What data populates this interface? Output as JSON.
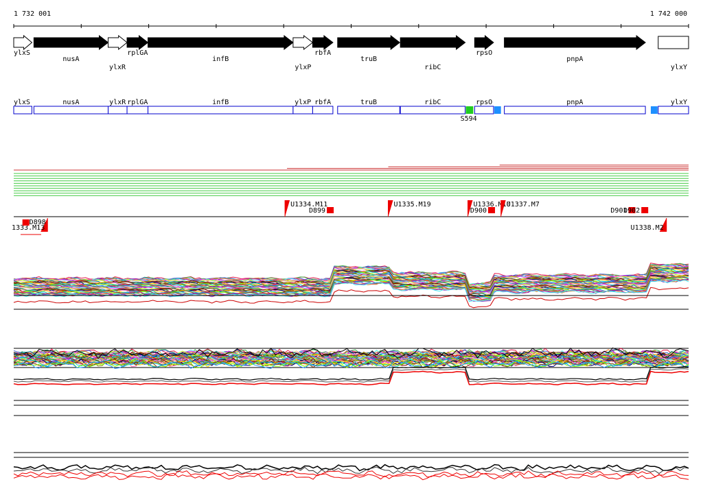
{
  "coords": {
    "start": "1 732 001",
    "end": "1 742 000"
  },
  "genes": [
    {
      "name": "ylxS",
      "start": 1732001,
      "end": 1732270,
      "strand": "+",
      "filled": false,
      "label_row": 1
    },
    {
      "name": "nusA",
      "start": 1732300,
      "end": 1733400,
      "strand": "+",
      "filled": true,
      "label_row": 2
    },
    {
      "name": "ylxR",
      "start": 1733400,
      "end": 1733680,
      "strand": "+",
      "filled": false,
      "label_row": 3
    },
    {
      "name": "rplGA",
      "start": 1733680,
      "end": 1733990,
      "strand": "+",
      "filled": true,
      "label_row": 1
    },
    {
      "name": "infB",
      "start": 1733990,
      "end": 1736140,
      "strand": "+",
      "filled": true,
      "label_row": 2
    },
    {
      "name": "ylxP",
      "start": 1736140,
      "end": 1736430,
      "strand": "+",
      "filled": false,
      "label_row": 3
    },
    {
      "name": "rbfA",
      "start": 1736430,
      "end": 1736730,
      "strand": "+",
      "filled": true,
      "label_row": 1
    },
    {
      "name": "truB",
      "start": 1736800,
      "end": 1737720,
      "strand": "+",
      "filled": true,
      "label_row": 2
    },
    {
      "name": "ribC",
      "start": 1737730,
      "end": 1738690,
      "strand": "+",
      "filled": true,
      "label_row": 3
    },
    {
      "name": "rpsO",
      "start": 1738830,
      "end": 1739110,
      "strand": "+",
      "filled": true,
      "label_row": 1
    },
    {
      "name": "pnpA",
      "start": 1739270,
      "end": 1741360,
      "strand": "+",
      "filled": true,
      "label_row": 2
    },
    {
      "name": "ylxY",
      "start": 1741550,
      "end": 1742000,
      "strand": "+",
      "filled": false,
      "label_row": 3
    }
  ],
  "features": [
    {
      "name": "S594",
      "start": 1738700,
      "end": 1738810,
      "color": "#22cc22"
    },
    {
      "name": "",
      "start": 1739120,
      "end": 1739220,
      "color": "#1e90ff"
    },
    {
      "name": "",
      "start": 1741440,
      "end": 1741540,
      "color": "#1e90ff"
    }
  ],
  "coverage_lines": {
    "green_count": 10,
    "red_lines": [
      {
        "start": 1732001,
        "end": 1742000
      },
      {
        "start": 1736050,
        "end": 1742000
      },
      {
        "start": 1737550,
        "end": 1742000
      },
      {
        "start": 1739200,
        "end": 1742000
      }
    ]
  },
  "segments_upper": [
    {
      "name": "U1334.M11",
      "pos": 1736020
    },
    {
      "name": "U1335.M19",
      "pos": 1737550
    },
    {
      "name": "U1336.M10",
      "pos": 1738730
    },
    {
      "name": "U1337.M7",
      "pos": 1739220
    }
  ],
  "segments_lower": [
    {
      "name": "1333.M13",
      "pos": 1732400
    },
    {
      "name": "U1338.M2",
      "pos": 1741570
    }
  ],
  "boxes": [
    {
      "name": "D898",
      "pos": 1732130,
      "row": "lower"
    },
    {
      "name": "D899",
      "pos": 1736640,
      "row": "upper"
    },
    {
      "name": "D900",
      "pos": 1739030,
      "row": "upper"
    },
    {
      "name": "D901",
      "pos": 1741110,
      "row": "upper"
    },
    {
      "name": "D902",
      "pos": 1741300,
      "row": "upper"
    }
  ],
  "profiles": {
    "breakpoints": [
      1732001,
      1736740,
      1737570,
      1738730,
      1739120,
      1741400,
      1742000
    ],
    "top_levels": [
      0.0,
      0.7,
      0.35,
      -0.3,
      0.2,
      0.85
    ],
    "mid_levels": [
      0.0,
      0.0,
      0.0,
      0.0,
      0.0,
      0.0
    ],
    "pair_levels": [
      0.0,
      0.0,
      0.72,
      0.0,
      0.0,
      0.72
    ],
    "bottom_levels": [
      0.0,
      0.0,
      0.0,
      0.0,
      0.0,
      0.0
    ]
  }
}
